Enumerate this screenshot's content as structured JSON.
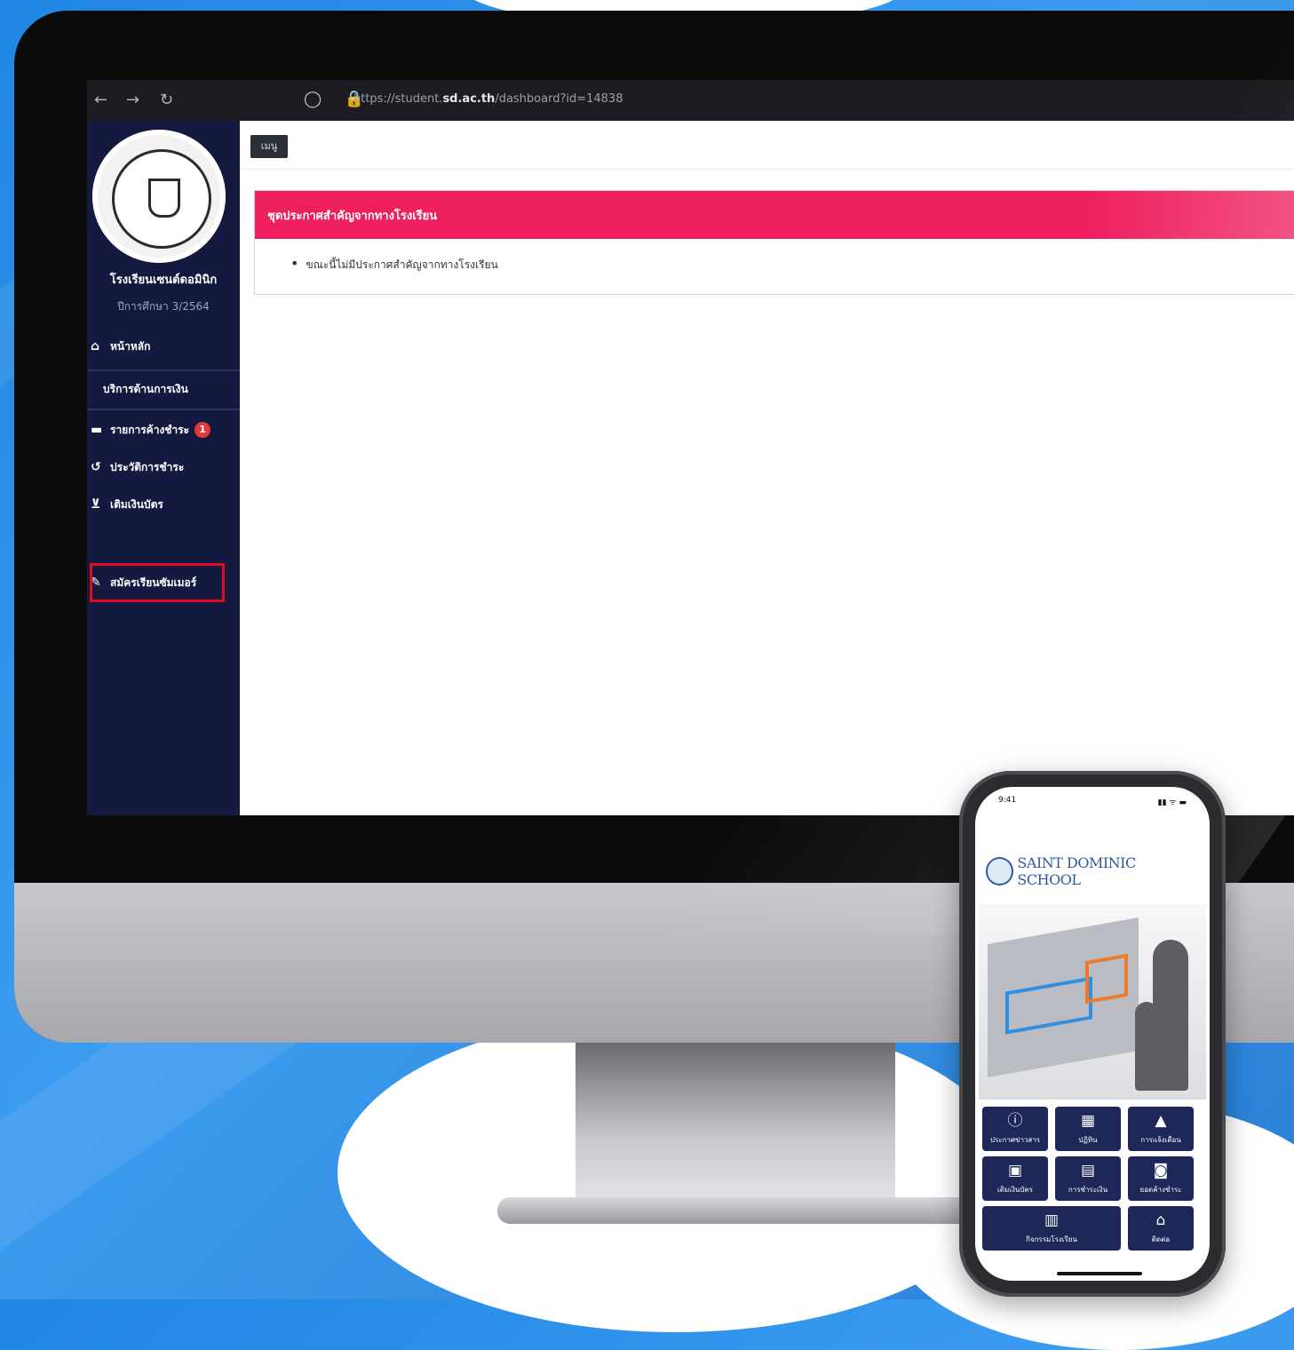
{
  "browser": {
    "back": "←",
    "forward": "→",
    "reload": "↻",
    "shield": "◯",
    "lock": "🔒",
    "url_prefix": "https://student.",
    "url_domain": "sd.ac.th",
    "url_path": "/dashboard?id=14838"
  },
  "sidebar": {
    "school_name": "โรงเรียนเซนต์ดอมินิก",
    "term": "ปีการศึกษา 3/2564",
    "items": [
      {
        "icon": "home-icon",
        "glyph": "⌂",
        "label": "หน้าหลัก"
      },
      {
        "icon": "",
        "glyph": "",
        "label": "บริการด้านการเงิน"
      },
      {
        "icon": "card-icon",
        "glyph": "▬",
        "label": "รายการค้างชำระ",
        "badge": "1"
      },
      {
        "icon": "history-icon",
        "glyph": "↺",
        "label": "ประวัติการชำระ"
      },
      {
        "icon": "cart-icon",
        "glyph": "⊻",
        "label": "เติมเงินบัตร"
      },
      {
        "icon": "pen-icon",
        "glyph": "✎",
        "label": "สมัครเรียนซัมเมอร์"
      }
    ]
  },
  "main": {
    "menu_button": "เมนู",
    "announcement_title": "ชุดประกาศสำคัญจากทางโรงเรียน",
    "announcement_item": "ขณะนี้ไม่มีประกาศสำคัญจากทางโรงเรียน"
  },
  "phone": {
    "time": "9:41",
    "signal": "▮▮ ᯤ ▬",
    "brand": "SAINT DOMINIC SCHOOL",
    "tiles": [
      {
        "icon": "info-icon",
        "glyph": "ⓘ",
        "label": "ประกาศข่าวสาร"
      },
      {
        "icon": "calendar-icon",
        "glyph": "▦",
        "label": "ปฏิทิน"
      },
      {
        "icon": "bell-icon",
        "glyph": "▲",
        "label": "การแจ้งเตือน"
      },
      {
        "icon": "wallet-icon",
        "glyph": "▣",
        "label": "เติมเงินบัตร"
      },
      {
        "icon": "id-card-icon",
        "glyph": "▤",
        "label": "การชำระเงิน"
      },
      {
        "icon": "cash-icon",
        "glyph": "◙",
        "label": "ยอดค้างชำระ"
      },
      {
        "icon": "activity-icon",
        "glyph": "▥",
        "label": "กิจกรรมโรงเรียน"
      },
      {
        "icon": "school-icon",
        "glyph": "⌂",
        "label": "ติดต่อ"
      }
    ]
  },
  "colors": {
    "sidebar": "#141a3f",
    "accent_pink": "#ee1f5d",
    "highlight_red": "#e00c1d",
    "background_blue": "#2a8ae6"
  }
}
